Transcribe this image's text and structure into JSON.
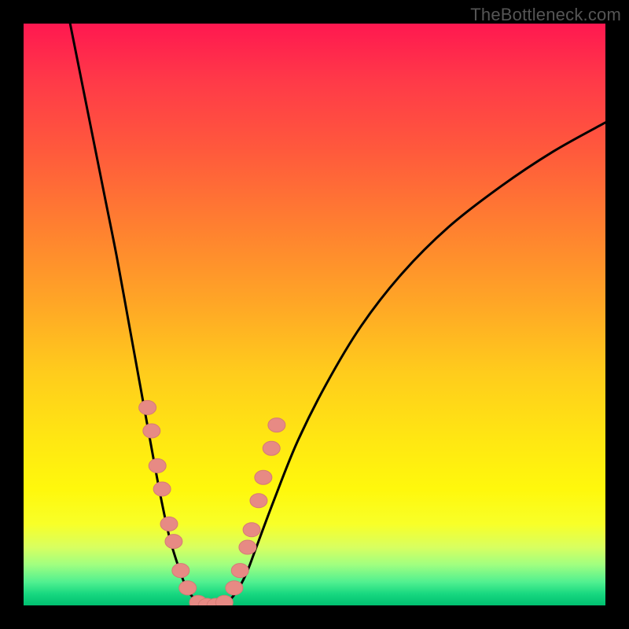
{
  "watermark": "TheBottleneck.com",
  "colors": {
    "frame": "#000000",
    "curve": "#000000",
    "marker_fill": "#e78a84",
    "marker_stroke": "#d57b75"
  },
  "chart_data": {
    "type": "line",
    "title": "",
    "xlabel": "",
    "ylabel": "",
    "xlim": [
      0,
      100
    ],
    "ylim": [
      0,
      100
    ],
    "annotations": [
      "TheBottleneck.com"
    ],
    "series": [
      {
        "name": "left-curve",
        "x": [
          8,
          10,
          12,
          14,
          16,
          18,
          20,
          22,
          23.5,
          25,
          26.5,
          28,
          29.5,
          31
        ],
        "y": [
          100,
          90,
          80,
          70,
          60,
          49,
          38,
          27,
          19,
          12,
          7,
          3,
          1,
          0
        ]
      },
      {
        "name": "right-curve",
        "x": [
          34,
          35.5,
          37,
          38.5,
          40,
          43,
          47,
          52,
          58,
          65,
          73,
          82,
          91,
          100
        ],
        "y": [
          0,
          1,
          3,
          6,
          10,
          18,
          28,
          38,
          48,
          57,
          65,
          72,
          78,
          83
        ]
      },
      {
        "name": "bottom-flat",
        "x": [
          31,
          32.5,
          34
        ],
        "y": [
          0,
          0,
          0
        ]
      }
    ],
    "markers": {
      "name": "highlighted-points",
      "points": [
        {
          "x": 21.3,
          "y": 34
        },
        {
          "x": 22.0,
          "y": 30
        },
        {
          "x": 23.0,
          "y": 24
        },
        {
          "x": 23.8,
          "y": 20
        },
        {
          "x": 25.0,
          "y": 14
        },
        {
          "x": 25.8,
          "y": 11
        },
        {
          "x": 27.0,
          "y": 6
        },
        {
          "x": 28.2,
          "y": 3
        },
        {
          "x": 30.0,
          "y": 0.5
        },
        {
          "x": 31.5,
          "y": 0
        },
        {
          "x": 33.0,
          "y": 0
        },
        {
          "x": 34.5,
          "y": 0.5
        },
        {
          "x": 36.2,
          "y": 3
        },
        {
          "x": 37.2,
          "y": 6
        },
        {
          "x": 38.5,
          "y": 10
        },
        {
          "x": 39.2,
          "y": 13
        },
        {
          "x": 40.4,
          "y": 18
        },
        {
          "x": 41.2,
          "y": 22
        },
        {
          "x": 42.6,
          "y": 27
        },
        {
          "x": 43.5,
          "y": 31
        }
      ]
    }
  }
}
